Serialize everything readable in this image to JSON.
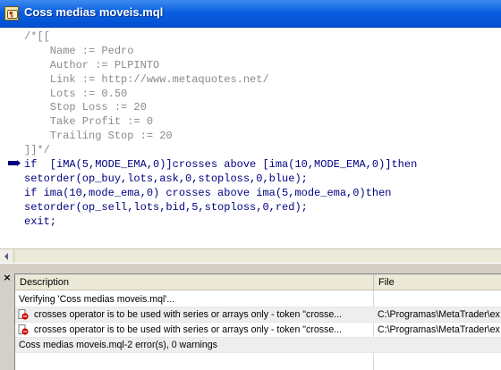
{
  "window": {
    "title": "Coss medias moveis.mql"
  },
  "editor": {
    "lines": [
      "/*[[",
      "    Name := Pedro",
      "    Author := PLPINTO",
      "    Link := http://www.metaquotes.net/",
      "    Lots := 0.50",
      "    Stop Loss := 20",
      "    Take Profit := 0",
      "    Trailing Stop := 20",
      "]]*/",
      "if  [iMA(5,MODE_EMA,0)]crosses above [ima(10,MODE_EMA,0)]then",
      "setorder(op_buy,lots,ask,0,stoploss,0,blue);",
      "if ima(10,mode_ema,0) crosses above ima(5,mode_ema,0)then",
      "setorder(op_sell,lots,bid,5,stoploss,0,red);",
      "exit;"
    ],
    "current_line_marker": "arrow-marker-icon"
  },
  "output": {
    "columns": {
      "description": "Description",
      "file": "File"
    },
    "rows": [
      {
        "icon": "",
        "description": "Verifying 'Coss medias moveis.mql'...",
        "file": ""
      },
      {
        "icon": "error-icon",
        "description": "crosses operator is to be used with series or arrays only - token \"crosse...",
        "file": "C:\\Programas\\MetaTrader\\ex"
      },
      {
        "icon": "error-icon",
        "description": "crosses operator is to be used with series or arrays only - token \"crosse...",
        "file": "C:\\Programas\\MetaTrader\\ex"
      },
      {
        "icon": "",
        "description": "Coss medias moveis.mql-2 error(s), 0 warnings",
        "file": ""
      }
    ],
    "close_label": "×"
  },
  "colors": {
    "titlebar": "#0a5fe0",
    "comment": "#8a8a8a",
    "keyword": "#000080",
    "function": "#800080",
    "error": "#cc0000"
  }
}
